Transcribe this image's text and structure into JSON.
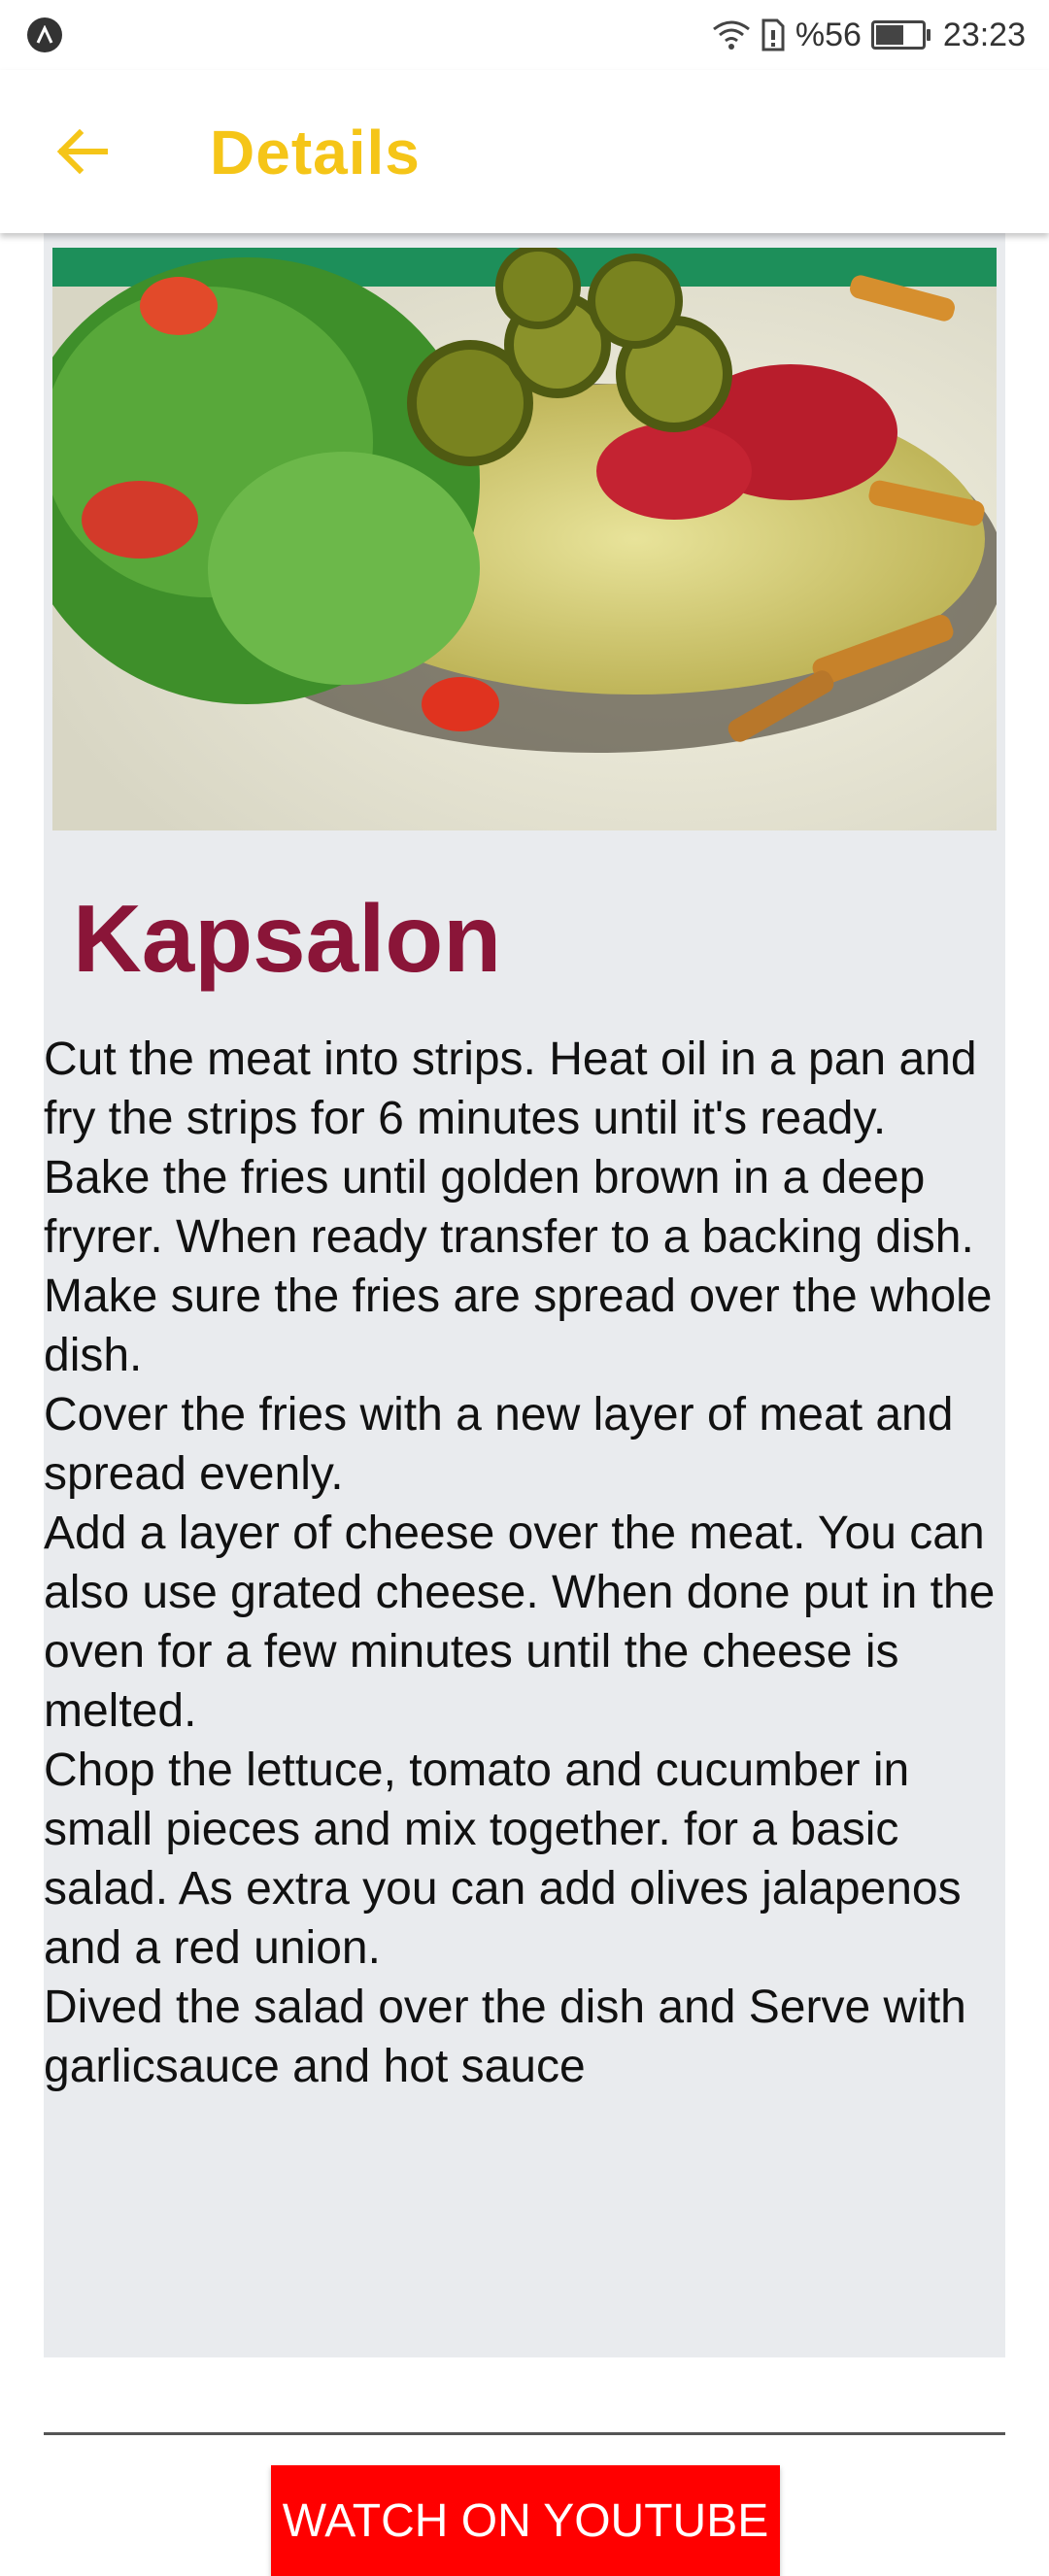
{
  "status_bar": {
    "battery_percent": "%56",
    "time": "23:23",
    "icons": [
      "app-notification-icon",
      "wifi-icon",
      "sim-icon",
      "battery-icon"
    ]
  },
  "app_bar": {
    "title": "Details",
    "back_icon": "arrow-back-icon",
    "accent_color": "#F5C518"
  },
  "recipe": {
    "title": "Kapsalon",
    "title_color": "#8a1538",
    "image_alt": "Kapsalon dish photo",
    "instructions": [
      "Cut the meat into strips. Heat oil in a pan and fry the strips for 6 minutes until it's ready.",
      "Bake the fries until golden brown in a deep fryrer. When ready transfer to a backing dish. Make sure the fries are spread over the whole dish.",
      "Cover the fries with a new layer of meat and spread evenly.",
      "Add a layer of cheese over the meat. You can also use grated cheese. When done put in the oven for a few minutes until the cheese is melted.",
      "Chop the lettuce, tomato and cucumber in small pieces and mix together. for a basic salad. As extra you can add olives jalapenos and a red union.",
      "Dived the salad over the dish and Serve with garlicsauce and hot sauce"
    ]
  },
  "actions": {
    "youtube_label": "WATCH ON YOUTUBE",
    "youtube_color": "#ff0000"
  }
}
